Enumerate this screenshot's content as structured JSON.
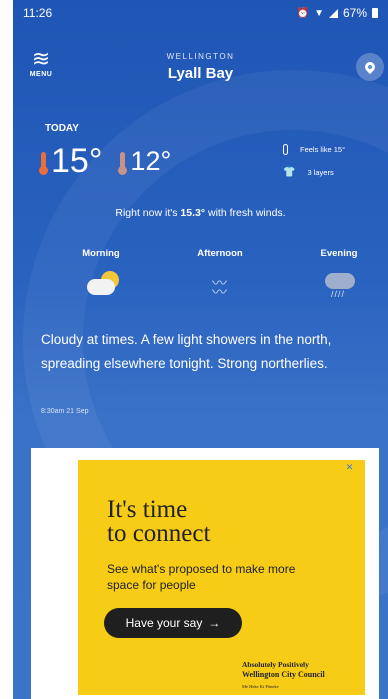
{
  "status_bar": {
    "time": "11:26",
    "battery": "67%"
  },
  "header": {
    "menu_label": "MENU",
    "region": "WELLINGTON",
    "suburb": "Lyall Bay"
  },
  "today": {
    "label": "TODAY",
    "high": "15°",
    "low": "12°",
    "feels_like": "Feels like 15°",
    "layers": "3 layers",
    "right_now_prefix": "Right now it's",
    "right_now_temp": "15.3°",
    "right_now_suffix": "with fresh winds."
  },
  "periods": [
    {
      "name": "Morning",
      "icon": "cloud-sun-icon"
    },
    {
      "name": "Afternoon",
      "icon": "wind-icon"
    },
    {
      "name": "Evening",
      "icon": "cloud-rain-icon"
    }
  ],
  "forecast": {
    "text": "Cloudy at times. A few light showers in the north, spreading elsewhere tonight. Strong northerlies.",
    "issued": "8:30am 21 Sep"
  },
  "ad": {
    "close": "✕",
    "headline_1": "It's time",
    "headline_2": "to connect",
    "subtext": "See what's proposed to make more space for people",
    "cta": "Have your say",
    "cta_arrow": "→",
    "council_1": "Absolutely Positively",
    "council_2": "Wellington City Council",
    "council_3": "Me Heke Ki Pōneke"
  },
  "colors": {
    "background": "#2a62c0",
    "ad_yellow": "#f7cc17",
    "thermo_hot": "#e86e3b"
  }
}
